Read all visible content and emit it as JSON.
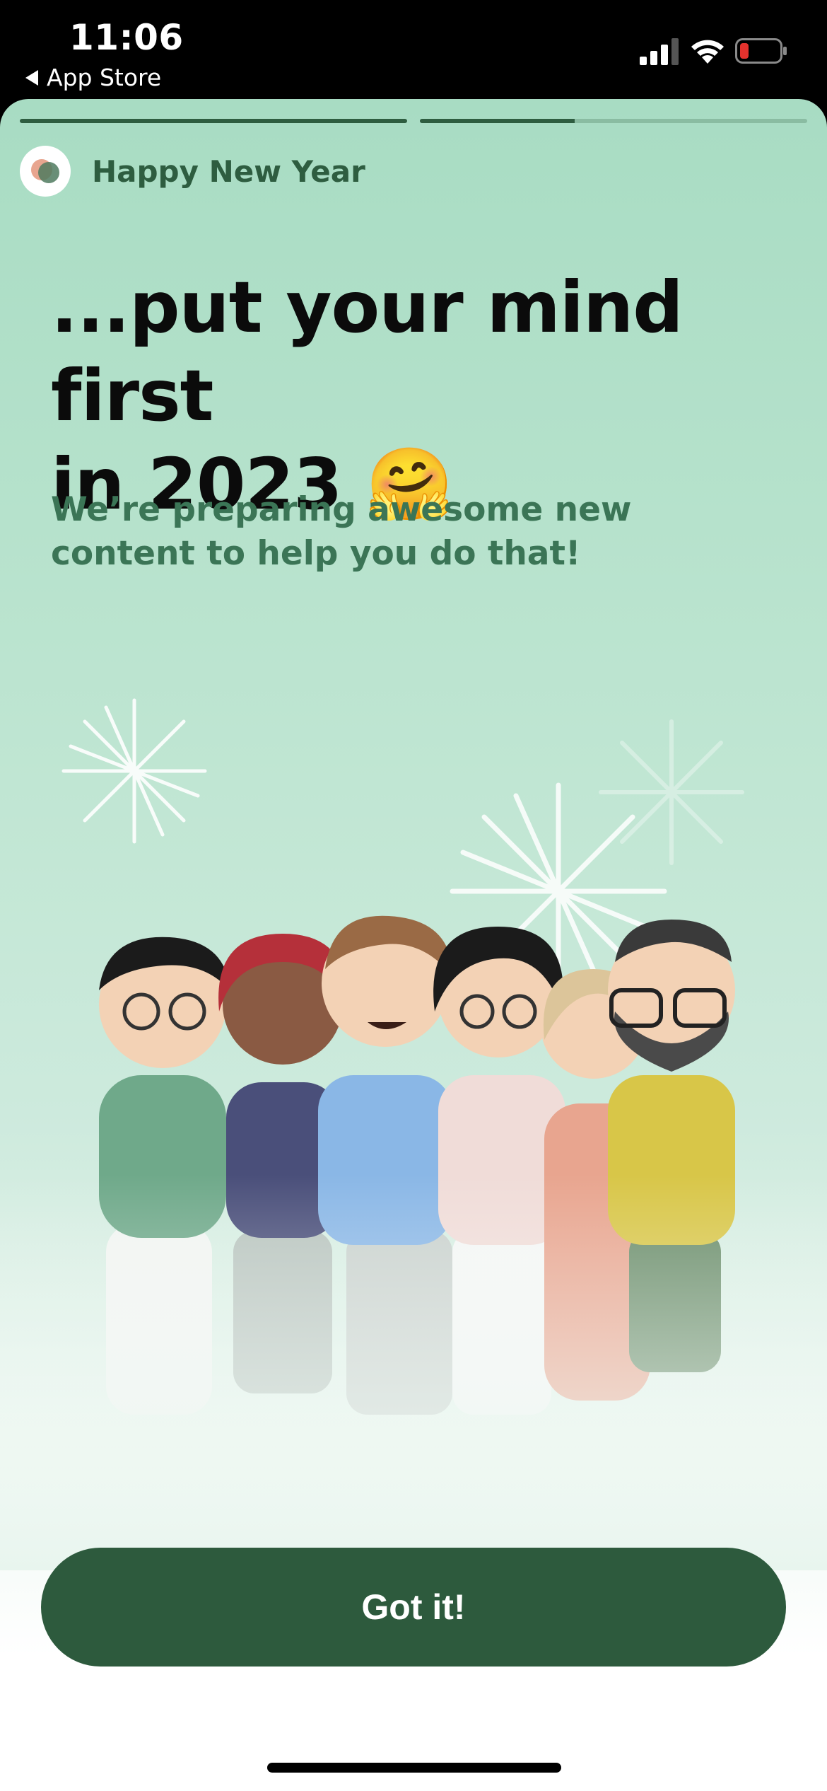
{
  "status_bar": {
    "time": "11:06",
    "back_app_label": "App Store",
    "icons": [
      "signal-icon",
      "wifi-icon",
      "battery-low-icon"
    ]
  },
  "story": {
    "progress": [
      1.0,
      0.4
    ],
    "title": "Happy New Year",
    "avatar_icon": "app-logo-icon"
  },
  "content": {
    "headline_line1": "...put your mind first",
    "headline_line2": "in 2023 🤗",
    "subtext": "We’re preparing awesome new content to help you do that!"
  },
  "illustration": {
    "icon": "group-of-friends-illustration"
  },
  "actions": {
    "got_it_label": "Got it!"
  },
  "colors": {
    "brand_dark_green": "#2d5a3d",
    "accent_text_green": "#3b7556",
    "background_mint": "#a8dcc3",
    "battery_red": "#e5322d"
  }
}
